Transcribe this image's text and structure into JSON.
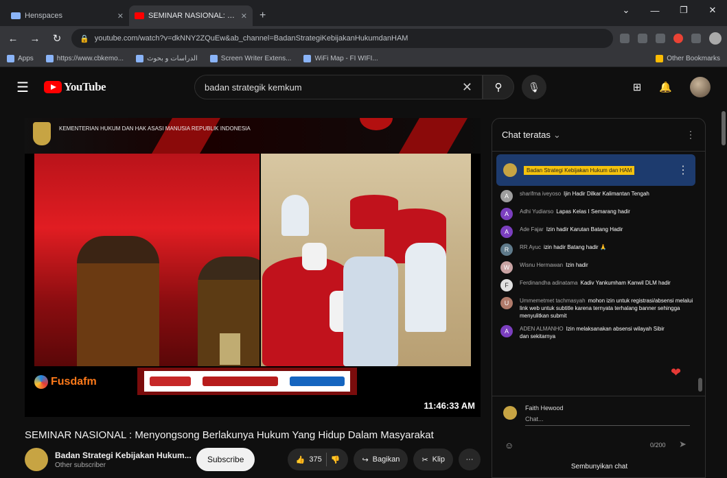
{
  "browser": {
    "tabs": [
      {
        "title": "Henspaces",
        "active": false
      },
      {
        "title": "SEMINAR NASIONAL: Meny...",
        "active": true
      }
    ],
    "new_tab": "+",
    "url": "youtube.com/watch?v=dkNNY2ZQuEw&ab_channel=BadanStrategiKebijakanHukumdanHAM",
    "bookmarks": [
      "Apps",
      "https://www.cbkemo...",
      "الدراسات و بحوث",
      "Screen Writer Extens...",
      "WiFi Map - FI WIFI..."
    ],
    "other_bookmarks": "Other Bookmarks"
  },
  "youtube": {
    "logo_text": "YouTube",
    "search_query": "badan strategik kemkum"
  },
  "video": {
    "header_text": "KEMENTERIAN HUKUM DAN HAK ASASI MANUSIA REPUBLIK INDONESIA",
    "fusda_label": "Fusdafm",
    "time": "11:46:33 AM",
    "title": "SEMINAR NASIONAL : Menyongsong Berlakunya Hukum Yang Hidup Dalam Masyarakat",
    "channel_name": "Badan Strategi Kebijakan Hukum...",
    "channel_subs": "Other subscriber",
    "subscribe_label": "Subscribe",
    "like_count": "375",
    "share_label": "Bagikan",
    "clip_label": "Klip",
    "more_label": "···"
  },
  "chat": {
    "header": "Chat teratas",
    "pinned_text": "Badan Strategi Kebijakan Hukum dan HAM",
    "messages": [
      {
        "initial": "A",
        "color": "#9e9e9e",
        "author": "sharifma iveyoso",
        "text": "Ijin Hadir Dilkar Kalimantan Tengah"
      },
      {
        "initial": "A",
        "color": "#7b3fbf",
        "author": "Adhi Yudiarso",
        "text": "Lapas Kelas I Semarang hadir"
      },
      {
        "initial": "A",
        "color": "#7b3fbf",
        "author": "Ade Fajar",
        "text": "Izin hadir Karutan Batang Hadir"
      },
      {
        "initial": "R",
        "color": "#5f7a8a",
        "author": "RR Ayuc",
        "text": "izin hadir Batang hadir 🙏"
      },
      {
        "initial": "W",
        "color": "#c9a3a3",
        "author": "Wisnu Hermawan",
        "text": "Izin hadir"
      },
      {
        "initial": "F",
        "color": "#e0e0e0",
        "author": "Ferdinandha adinatama",
        "text": "Kadiv Yankumham Kanwil DLM hadir"
      },
      {
        "initial": "U",
        "color": "#b07a6a",
        "author": "Ummemetmet tachmasyah",
        "text": "mohon izin untuk registrasi/absensi melalui link web untuk subtitle karena ternyata terhalang banner sehingga menyulitkan submit"
      },
      {
        "initial": "A",
        "color": "#7b3fbf",
        "author": "ADEN ALMANHO",
        "text": "Izin melaksanakan absensi wilayah Sibir dan sekitarnya"
      }
    ],
    "input_name": "Faith Hewood",
    "input_placeholder": "Chat...",
    "char_count": "0/200",
    "footer": "Sembunyikan chat"
  }
}
